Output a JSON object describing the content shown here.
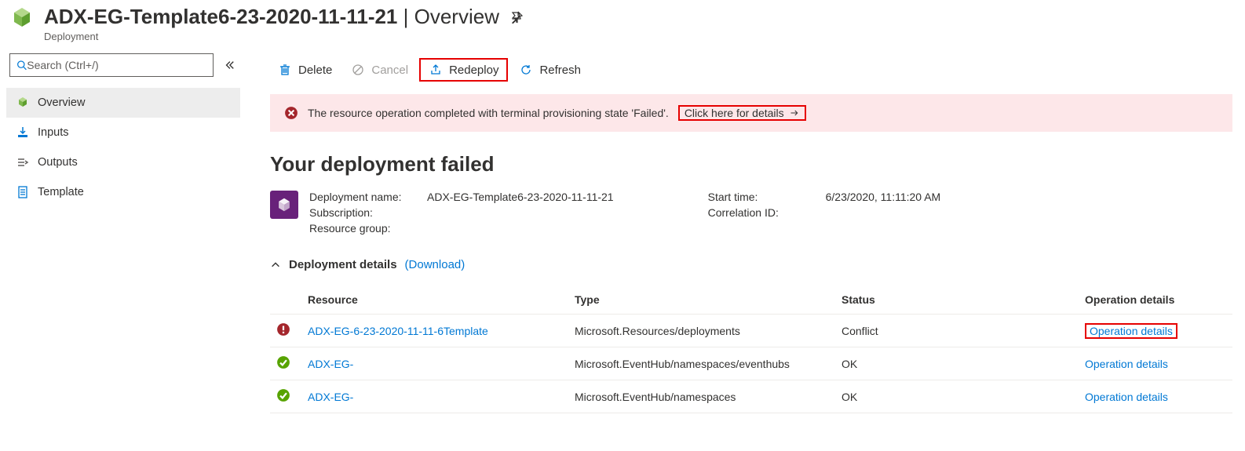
{
  "header": {
    "title": "ADX-EG-Template6-23-2020-11-11-21",
    "section": "Overview",
    "subtitle": "Deployment"
  },
  "search": {
    "placeholder": "Search (Ctrl+/)"
  },
  "sidebar": {
    "items": [
      {
        "label": "Overview",
        "active": true
      },
      {
        "label": "Inputs",
        "active": false
      },
      {
        "label": "Outputs",
        "active": false
      },
      {
        "label": "Template",
        "active": false
      }
    ]
  },
  "toolbar": {
    "delete": "Delete",
    "cancel": "Cancel",
    "redeploy": "Redeploy",
    "refresh": "Refresh"
  },
  "alert": {
    "text": "The resource operation completed with terminal provisioning state 'Failed'.",
    "details_link": "Click here for details"
  },
  "heading": "Your deployment failed",
  "summary": {
    "deployment_name_label": "Deployment name:",
    "deployment_name": "ADX-EG-Template6-23-2020-11-11-21",
    "subscription_label": "Subscription:",
    "subscription": "",
    "resource_group_label": "Resource group:",
    "resource_group": "",
    "start_time_label": "Start time:",
    "start_time": "6/23/2020, 11:11:20 AM",
    "correlation_label": "Correlation ID:",
    "correlation": ""
  },
  "details": {
    "title": "Deployment details",
    "download": "(Download)"
  },
  "table": {
    "headers": {
      "resource": "Resource",
      "type": "Type",
      "status": "Status",
      "op": "Operation details"
    },
    "rows": [
      {
        "status": "error",
        "resource": "ADX-EG-6-23-2020-11-11-6Template",
        "type": "Microsoft.Resources/deployments",
        "statusText": "Conflict",
        "op": "Operation details",
        "boxed": true
      },
      {
        "status": "ok",
        "resource": "ADX-EG-",
        "type": "Microsoft.EventHub/namespaces/eventhubs",
        "statusText": "OK",
        "op": "Operation details",
        "boxed": false
      },
      {
        "status": "ok",
        "resource": "ADX-EG-",
        "type": "Microsoft.EventHub/namespaces",
        "statusText": "OK",
        "op": "Operation details",
        "boxed": false
      }
    ]
  }
}
